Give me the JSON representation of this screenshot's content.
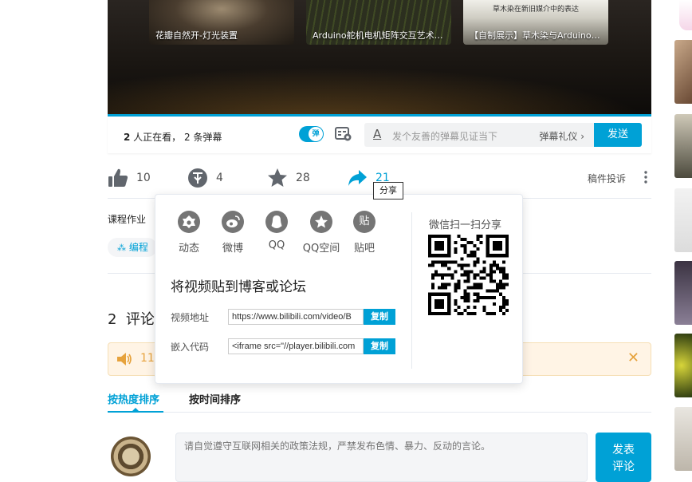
{
  "video": {
    "related": [
      {
        "caption": "花瓣自然开-灯光装置"
      },
      {
        "caption": "Arduino舵机电机矩阵交互艺术强..."
      },
      {
        "caption": "【自制展示】草木染与Arduino物...",
        "top_text": "草木染在新旧媒介中的表达"
      }
    ]
  },
  "danmaku": {
    "viewers_count": "2",
    "viewers_text": " 人正在看，",
    "danmaku_count_text": "2 条弹幕",
    "toggle_label": "弹",
    "input_placeholder": "发个友善的弹幕见证当下",
    "gift_label": "弹幕礼仪 ›",
    "send_label": "发送"
  },
  "actions": {
    "like_count": "10",
    "coin_count": "4",
    "favorite_count": "28",
    "share_count": "21",
    "share_tooltip": "分享",
    "report_label": "稿件投诉"
  },
  "tags": {
    "section_label": "课程作业",
    "edit_label": "编程"
  },
  "share_popup": {
    "items": [
      {
        "label": "动态"
      },
      {
        "label": "微博"
      },
      {
        "label": "QQ"
      },
      {
        "label": "QQ空间"
      },
      {
        "label": "贴吧",
        "glyph": "贴"
      }
    ],
    "embed_title": "将视频贴到博客或论坛",
    "video_url_label": "视频地址",
    "video_url_value": "https://www.bilibili.com/video/B",
    "embed_code_label": "嵌入代码",
    "embed_code_value": "<iframe src=\"//player.bilibili.com",
    "copy_label": "复制",
    "wechat_title": "微信扫一扫分享"
  },
  "comments": {
    "count": "2",
    "title": "评论",
    "notice_text": "11,",
    "sort_hot": "按热度排序",
    "sort_time": "按时间排序",
    "input_placeholder": "请自觉遵守互联网相关的政策法规，严禁发布色情、暴力、反动的言论。",
    "submit_line1": "发表",
    "submit_line2": "评论"
  },
  "colors": {
    "accent": "#00a1d6",
    "icon_gray": "#757575",
    "notice_bg": "#fff4e5",
    "notice_fg": "#e6a23c"
  }
}
